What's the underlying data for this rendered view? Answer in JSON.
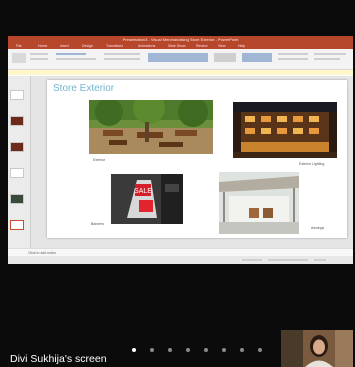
{
  "window": {
    "title": "Presentation3 - Visual Merchandising Store Exterior - PowerPoint"
  },
  "menu": [
    "File",
    "Home",
    "Insert",
    "Design",
    "Transitions",
    "Animations",
    "Slide Show",
    "Review",
    "View",
    "Help"
  ],
  "notice_text": "",
  "slide": {
    "title": "Store Exterior",
    "captions": {
      "pic1": "Exterior",
      "pic2": "Exterior Lighting",
      "pic3": "Banners",
      "pic4": "Awnings"
    }
  },
  "notes_placeholder": "Click to add notes",
  "call": {
    "screen_label": "Divi Sukhija's screen",
    "page_dots": 8,
    "active_dot": 0
  },
  "colors": {
    "titlebar": "#b7472a",
    "slide_title": "#74b6d0"
  }
}
